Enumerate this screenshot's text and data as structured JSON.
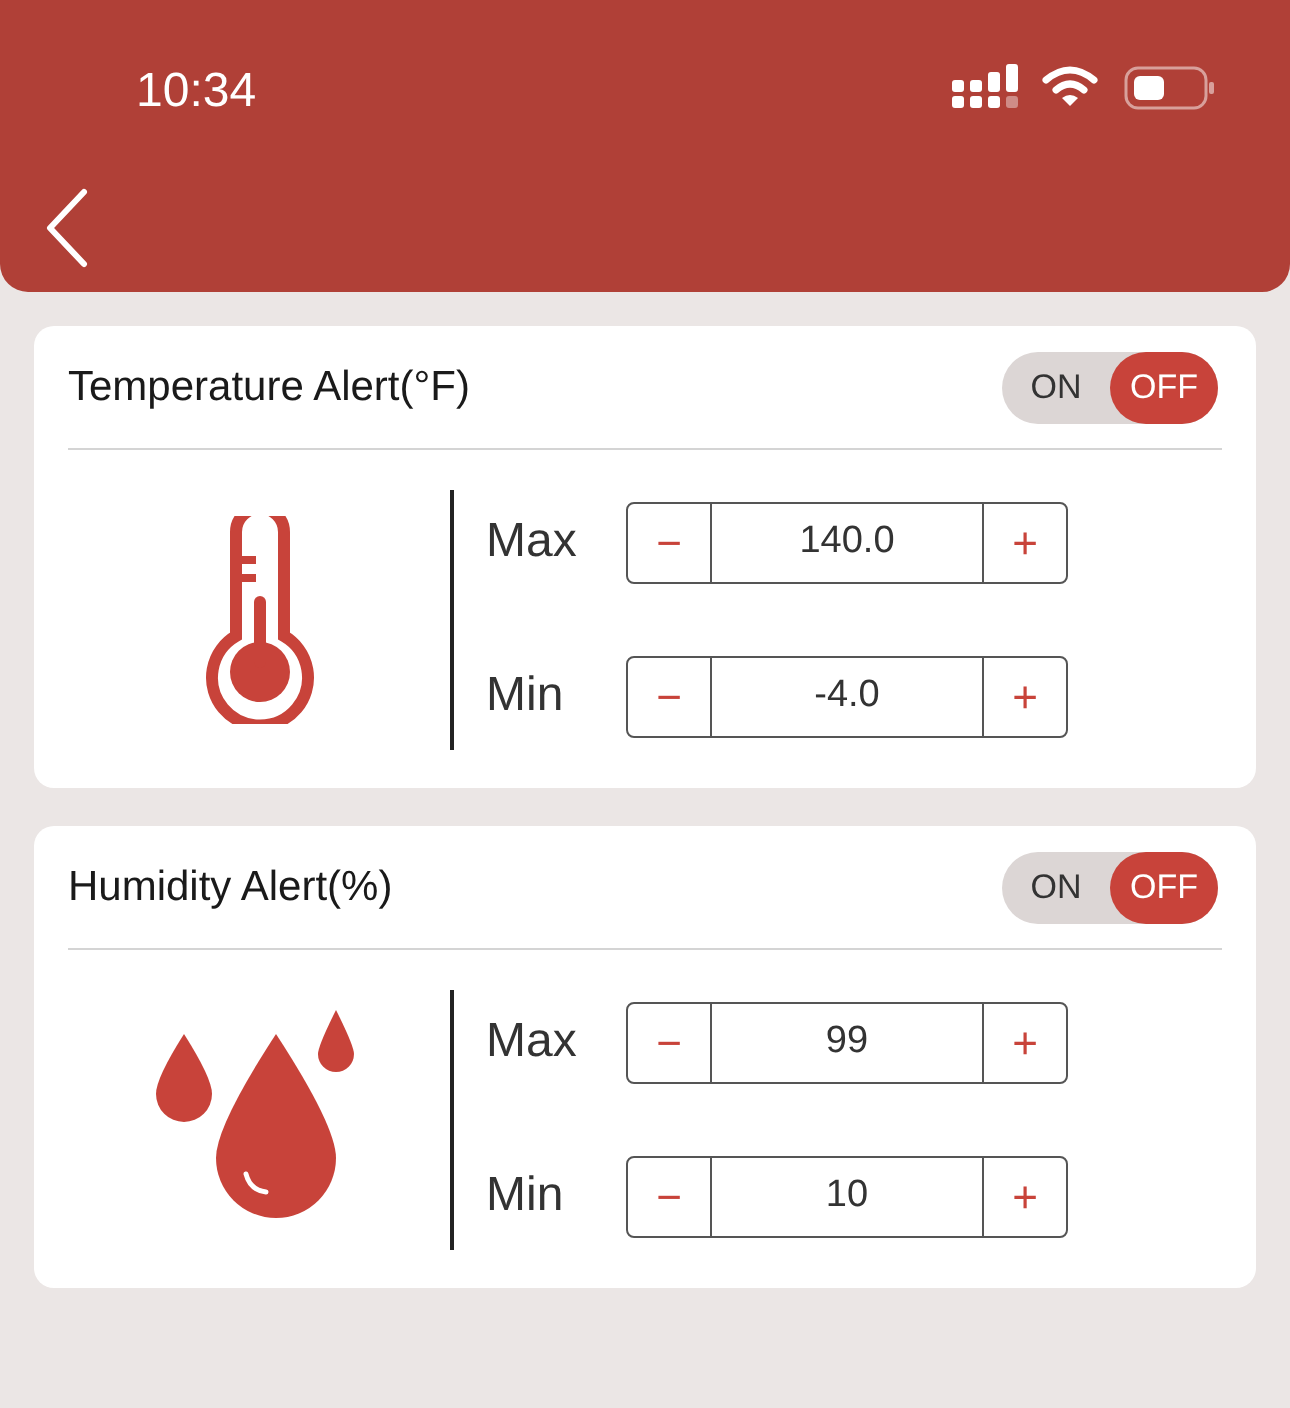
{
  "status_bar": {
    "time": "10:34"
  },
  "alerts": [
    {
      "kind": "temperature",
      "title": "Temperature Alert(°F)",
      "toggle": {
        "on_label": "ON",
        "off_label": "OFF",
        "on": false
      },
      "limits": [
        {
          "label": "Max",
          "decrement": "−",
          "value": "140.0",
          "increment": "+"
        },
        {
          "label": "Min",
          "decrement": "−",
          "value": "-4.0",
          "increment": "+"
        }
      ]
    },
    {
      "kind": "humidity",
      "title": "Humidity Alert(%)",
      "toggle": {
        "on_label": "ON",
        "off_label": "OFF",
        "on": false
      },
      "limits": [
        {
          "label": "Max",
          "decrement": "−",
          "value": "99",
          "increment": "+"
        },
        {
          "label": "Min",
          "decrement": "−",
          "value": "10",
          "increment": "+"
        }
      ]
    }
  ]
}
